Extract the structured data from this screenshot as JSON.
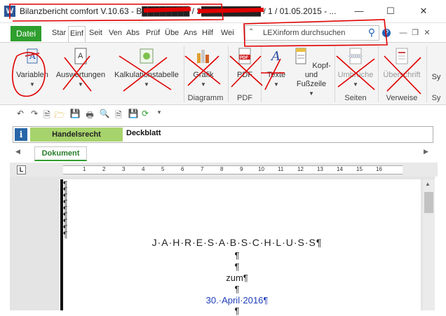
{
  "window": {
    "title": "Bilanzbericht comfort V.10.63 - B████████ / 3██████████ / 1 / 01.05.2015 - ...",
    "minimize": "—",
    "maximize": "☐",
    "close": "✕"
  },
  "tabs": {
    "file": "Datei",
    "items": [
      "Star",
      "Einf",
      "Seit",
      "Ven",
      "Abs",
      "Prüf",
      "Übe",
      "Ans",
      "Hilf",
      "Wei"
    ]
  },
  "search": {
    "placeholder": "LEXinform durchsuchen"
  },
  "ribbon": {
    "variablen": "Variablen",
    "auswertungen": "Auswertungen",
    "kalkulation": "Kalkulationstabelle",
    "grafik": "Grafik",
    "pdf": "PDF",
    "texte": "Texte",
    "kopf": "Kopf- und",
    "fusszeile": "Fußzeile",
    "umbrueche": "Umbrüche",
    "ueberschrift": "Überschrift",
    "sy": "Sy",
    "group_diagramm": "Diagramm",
    "group_pdf": "PDF",
    "group_seiten": "Seiten",
    "group_verweise": "Verweise",
    "group_sy": "Sy"
  },
  "info": {
    "icon": "i",
    "category": "Handelsrecht",
    "section": "Deckblatt"
  },
  "doc_tab": "Dokument",
  "ruler": [
    "1",
    "2",
    "3",
    "4",
    "5",
    "6",
    "7",
    "8",
    "9",
    "10",
    "11",
    "12",
    "13",
    "14",
    "15",
    "16"
  ],
  "document": {
    "pilcrow": "¶",
    "heading": "J·A·H·R·E·S·A·B·S·C·H·L·U·S·S¶",
    "zum": "zum¶",
    "date": "30.·April·2016¶",
    "date_color": "#1f3fb8"
  },
  "colors": {
    "file_tab": "#2e9f2e",
    "category_bg": "#a7d36c",
    "annotation": "#e00000"
  }
}
